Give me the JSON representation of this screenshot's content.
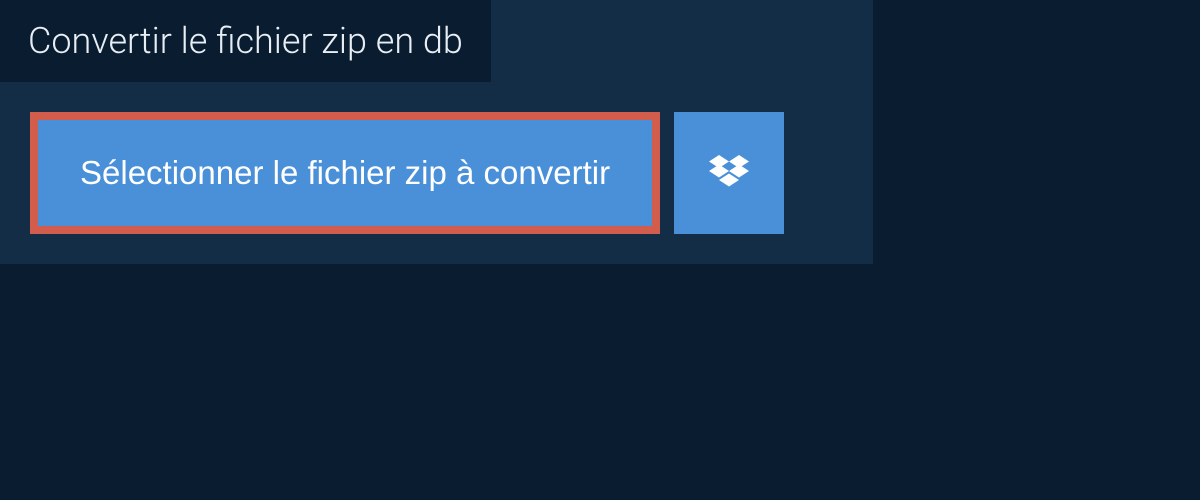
{
  "title": "Convertir le fichier zip en db",
  "select_button_label": "Sélectionner le fichier zip à convertir",
  "colors": {
    "page_bg": "#0a1d30",
    "panel_bg": "#142d47",
    "button_bg": "#4a90d9",
    "highlight_border": "#d35d4c",
    "text_light": "#e8eef4",
    "text_white": "#ffffff"
  }
}
